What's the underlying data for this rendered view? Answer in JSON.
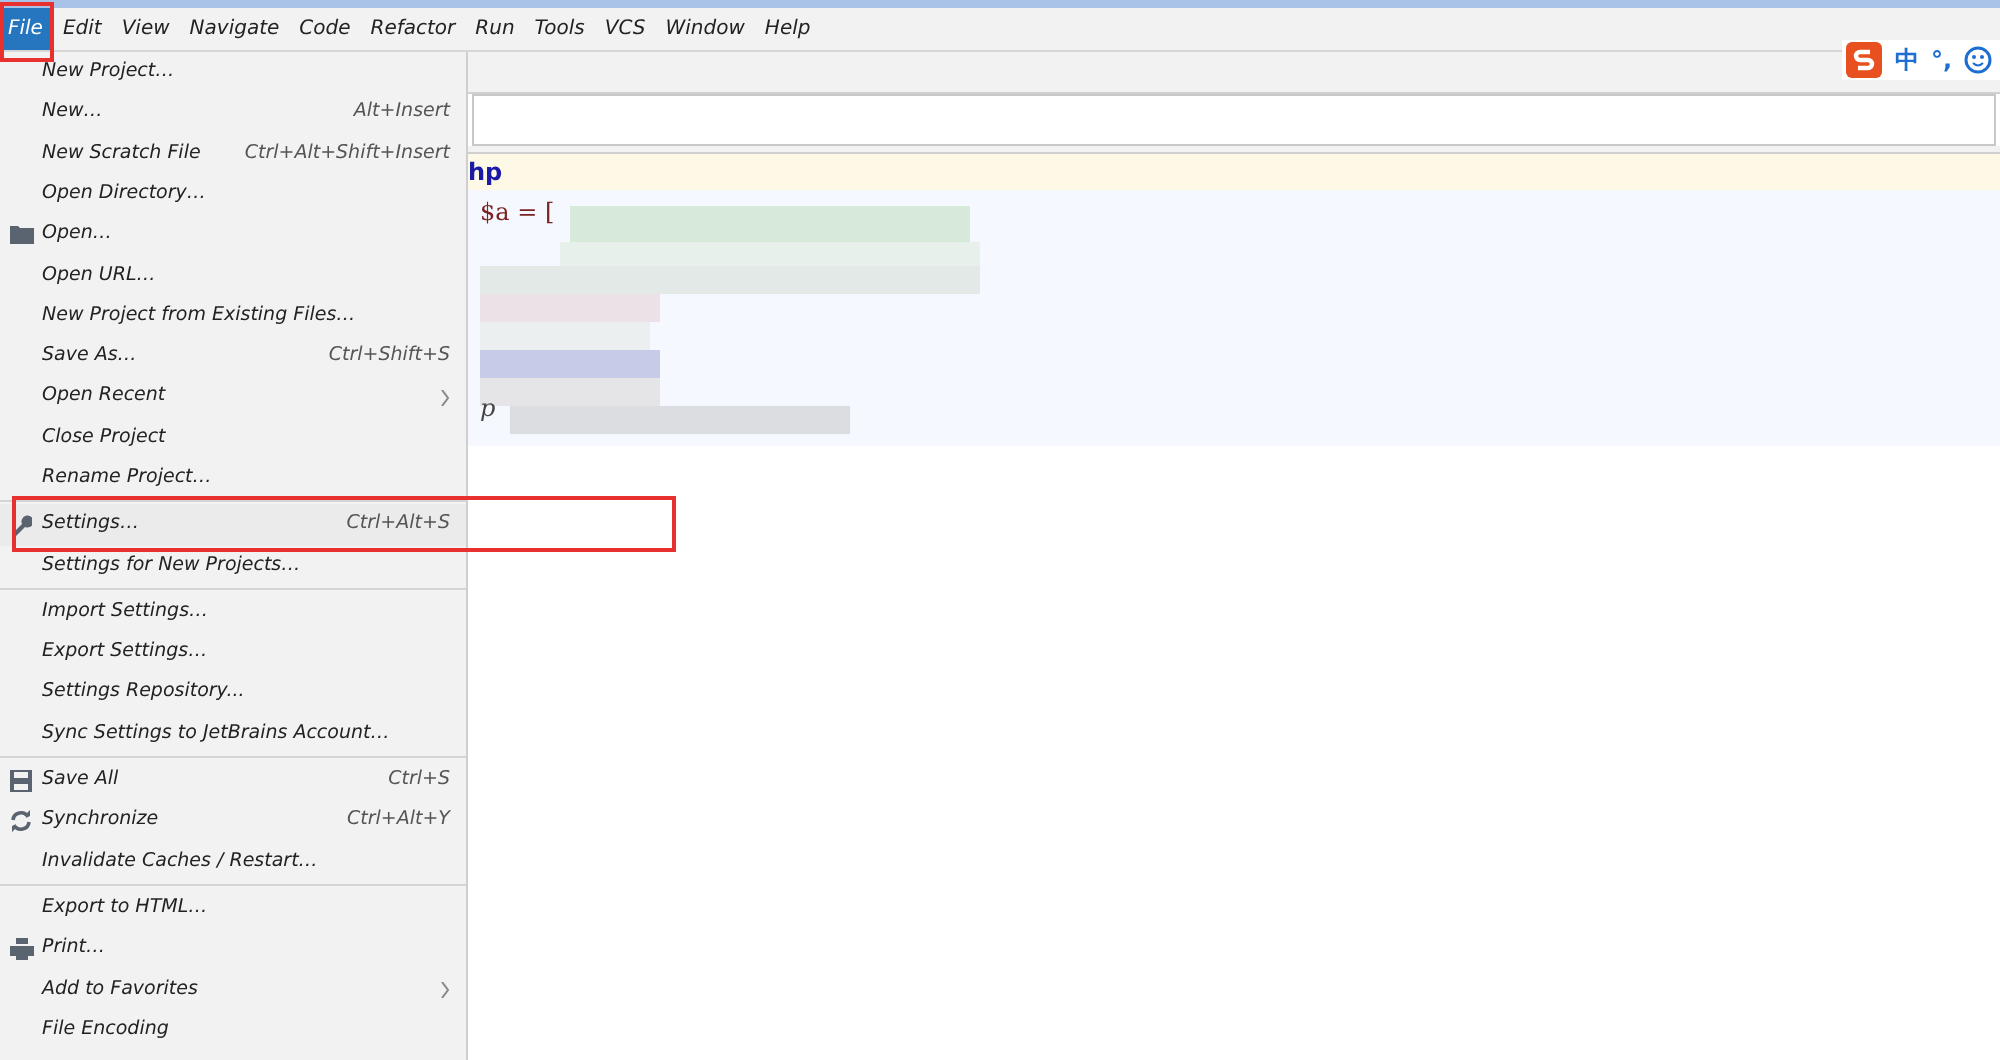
{
  "menu_bar": [
    {
      "label": "File",
      "selected": true
    },
    {
      "label": "Edit",
      "selected": false
    },
    {
      "label": "View",
      "selected": false
    },
    {
      "label": "Navigate",
      "selected": false
    },
    {
      "label": "Code",
      "selected": false
    },
    {
      "label": "Refactor",
      "selected": false
    },
    {
      "label": "Run",
      "selected": false
    },
    {
      "label": "Tools",
      "selected": false
    },
    {
      "label": "VCS",
      "selected": false
    },
    {
      "label": "Window",
      "selected": false
    },
    {
      "label": "Help",
      "selected": false
    }
  ],
  "ime_toolbar": {
    "mode": "中",
    "punctuation": "°,"
  },
  "file_menu": [
    {
      "label": "New Project…"
    },
    {
      "label": "New…",
      "shortcut": "Alt+Insert"
    },
    {
      "label": "New Scratch File",
      "shortcut": "Ctrl+Alt+Shift+Insert"
    },
    {
      "label": "Open Directory…"
    },
    {
      "label": "Open…",
      "kind": "folder"
    },
    {
      "label": "Open URL…"
    },
    {
      "label": "New Project from Existing Files…"
    },
    {
      "label": "Save As…",
      "shortcut": "Ctrl+Shift+S"
    },
    {
      "label": "Open Recent",
      "submenu": true
    },
    {
      "label": "Close Project"
    },
    {
      "label": "Rename Project…",
      "separator_after": true
    },
    {
      "label": "Settings…",
      "shortcut": "Ctrl+Alt+S",
      "kind": "wrench",
      "highlighted": true
    },
    {
      "label": "Settings for New Projects…",
      "separator_after": true
    },
    {
      "label": "Import Settings…"
    },
    {
      "label": "Export Settings…"
    },
    {
      "label": "Settings Repository..."
    },
    {
      "label": "Sync Settings to JetBrains Account…",
      "separator_after": true
    },
    {
      "label": "Save All",
      "shortcut": "Ctrl+S",
      "kind": "save"
    },
    {
      "label": "Synchronize",
      "shortcut": "Ctrl+Alt+Y",
      "kind": "sync"
    },
    {
      "label": "Invalidate Caches / Restart…",
      "separator_after": true
    },
    {
      "label": "Export to HTML…"
    },
    {
      "label": "Print…",
      "kind": "print"
    },
    {
      "label": "Add to Favorites",
      "submenu": true
    },
    {
      "label": "File Encoding"
    }
  ],
  "editor": {
    "header_line": "hp",
    "lines": [
      "$a = [",
      "p"
    ]
  }
}
